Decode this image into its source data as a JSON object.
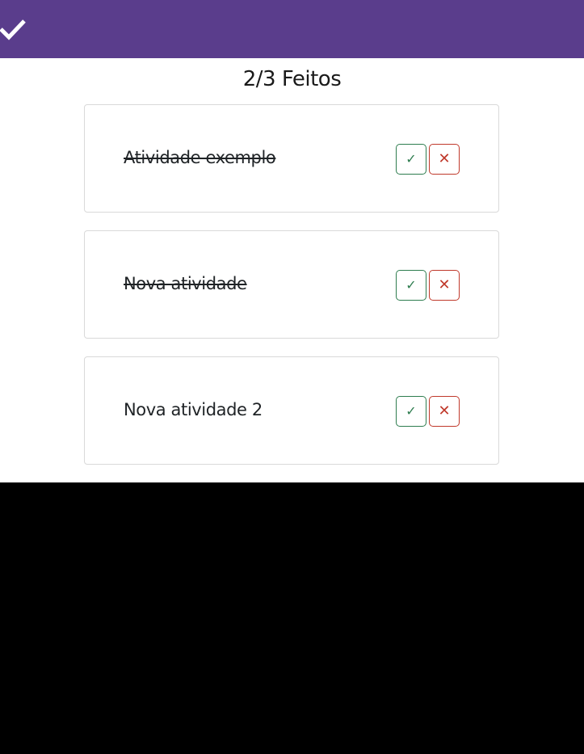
{
  "app": {
    "logo_icon": "checkmark-icon",
    "brand_color": "#5a3d8c"
  },
  "counter": {
    "text": "2/3 Feitos"
  },
  "tasks": [
    {
      "label": "Atividade exemplo",
      "done": true,
      "done_button": "✓",
      "remove_button": "✕"
    },
    {
      "label": "Nova atividade",
      "done": true,
      "done_button": "✓",
      "remove_button": "✕"
    },
    {
      "label": "Nova atividade 2",
      "done": false,
      "done_button": "✓",
      "remove_button": "✕"
    }
  ],
  "colors": {
    "done_green": "#2e7d4f",
    "remove_red": "#c0392b"
  }
}
